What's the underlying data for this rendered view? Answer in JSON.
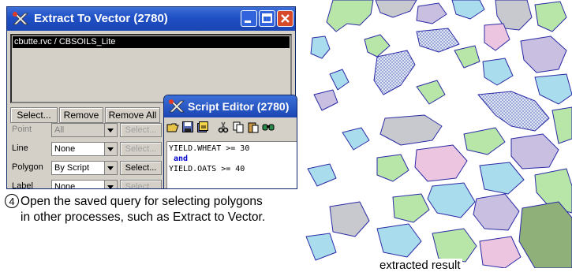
{
  "extract_window": {
    "title": "Extract To Vector (2780)",
    "list_items": [
      "cbutte.rvc / CBSOILS_Lite"
    ],
    "buttons": {
      "select": "Select...",
      "remove": "Remove",
      "remove_all": "Remove All"
    },
    "rows": [
      {
        "label": "Point",
        "value": "All",
        "button": "Select...",
        "enabled": false
      },
      {
        "label": "Line",
        "value": "None",
        "button": "Select...",
        "enabled": true
      },
      {
        "label": "Polygon",
        "value": "By Script",
        "button": "Select...",
        "enabled": true
      },
      {
        "label": "Label",
        "value": "None",
        "button": "Select...",
        "enabled": false
      }
    ]
  },
  "script_editor": {
    "title": "Script Editor (2780)",
    "toolbar_icons": [
      "open-folder-icon",
      "save-icon",
      "save-as-icon",
      "cut-icon",
      "copy-icon",
      "paste-icon",
      "find-icon"
    ],
    "lines": [
      "YIELD.WHEAT >= 30",
      "and",
      "YIELD.OATS >= 40"
    ]
  },
  "caption": {
    "step_number": "4",
    "text": "Open the saved query for selecting polygons in other processes, such as Extract to Vector."
  },
  "map": {
    "label": "extracted result",
    "colors": {
      "outline": "#2a2aa6",
      "green": "#b8e6a8",
      "cyan": "#a9dcec",
      "purple": "#c9bfe0",
      "pink": "#ecc6e0",
      "gray": "#c8c8cf",
      "olive": "#8fb078"
    }
  }
}
